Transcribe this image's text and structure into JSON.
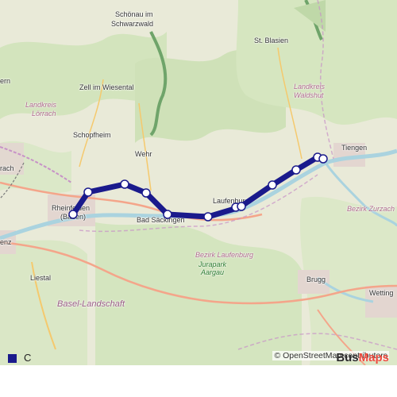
{
  "map": {
    "places": [
      {
        "name": "Schönau im"
      },
      {
        "name": "Schwarzwald"
      },
      {
        "name": "St. Blasien"
      },
      {
        "name": "Zell im Wiesental"
      },
      {
        "name": "Schopfheim"
      },
      {
        "name": "Wehr"
      },
      {
        "name": "Tiengen"
      },
      {
        "name": "Rheinfelden"
      },
      {
        "name": "(Baden)"
      },
      {
        "name": "Bad Säckingen"
      },
      {
        "name": "Laufenburg"
      },
      {
        "name": "Liestal"
      },
      {
        "name": "Brugg"
      },
      {
        "name": "Wetting"
      },
      {
        "name": "ern"
      },
      {
        "name": "rach"
      },
      {
        "name": "enz"
      }
    ],
    "admin_labels": [
      {
        "name": "Landkreis"
      },
      {
        "name": "Lörrach"
      },
      {
        "name": "Landkreis"
      },
      {
        "name": "Waldshut"
      },
      {
        "name": "Bezirk Laufenburg"
      },
      {
        "name": "Bezirk Zurzach"
      },
      {
        "name": "Basel-Landschaft"
      }
    ],
    "park": [
      "Jurapark",
      "Aargau"
    ],
    "route_color": "#1a1a8c",
    "stops_count": 12
  },
  "attribution": "© OpenStreetMap contributors",
  "legend": {
    "label": "C",
    "color": "#1a1a8c"
  },
  "brand": {
    "part1": "Bus",
    "part2": "Maps"
  }
}
